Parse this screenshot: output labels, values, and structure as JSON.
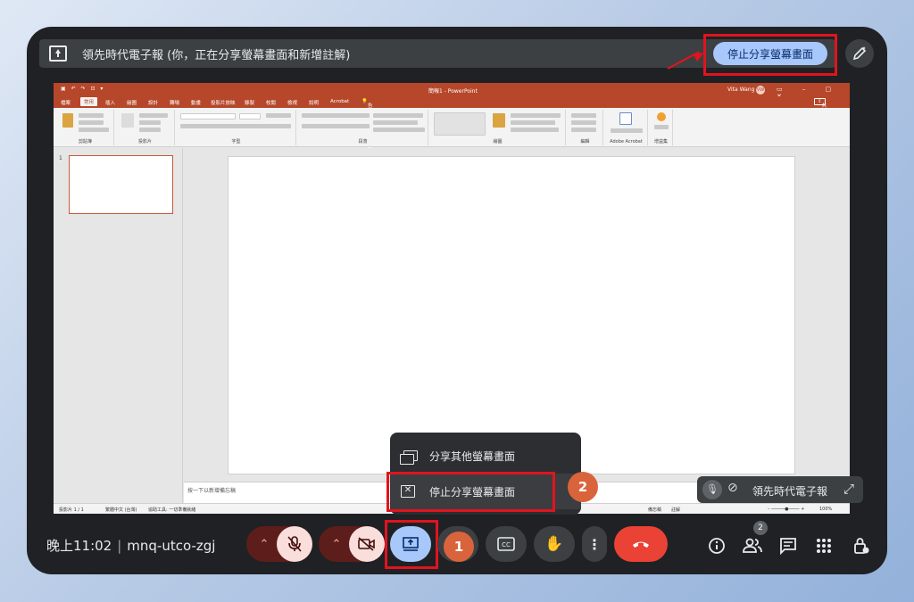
{
  "banner": {
    "text": "領先時代電子報 (你，正在分享螢幕畫面和新增註解)",
    "stop_label": "停止分享螢幕畫面"
  },
  "ppt": {
    "title": "簡報1 - PowerPoint",
    "user": "Vita Wang",
    "user_initials": "VW",
    "tabs": [
      "檔案",
      "常用",
      "插入",
      "繪圖",
      "設計",
      "轉場",
      "動畫",
      "投影片放映",
      "錄製",
      "校閱",
      "檢視",
      "說明",
      "Acrobat"
    ],
    "active_tab": "常用",
    "search": "告訴我您想做什麼",
    "share_label": "共用",
    "groups": [
      "剪貼簿",
      "投影片",
      "字型",
      "段落",
      "繪圖",
      "編輯",
      "Adobe Acrobat",
      "增益集"
    ],
    "slide_number": "1",
    "notes_placeholder": "按一下以新增備忘稿",
    "status_slide": "投影片 1 / 1",
    "status_lang": "繁體中文 (台灣)",
    "status_access": "協助工具: 一切準備就緒",
    "status_notes": "備忘稿",
    "status_comments": "註解",
    "zoom": "100%"
  },
  "menu": {
    "share_other": "分享其他螢幕畫面",
    "stop_share": "停止分享螢幕畫面"
  },
  "annotations": {
    "badge1": "1",
    "badge2": "2"
  },
  "pip": {
    "name": "領先時代電子報"
  },
  "footer": {
    "time": "晚上11:02",
    "meeting_code": "mnq-utco-zgj",
    "participants_count": "2"
  },
  "colors": {
    "accent": "#a8c7fa",
    "highlight_red": "#e0141e",
    "badge": "#d9643c",
    "ppt_brand": "#b7472a",
    "end_call": "#ea4335"
  }
}
